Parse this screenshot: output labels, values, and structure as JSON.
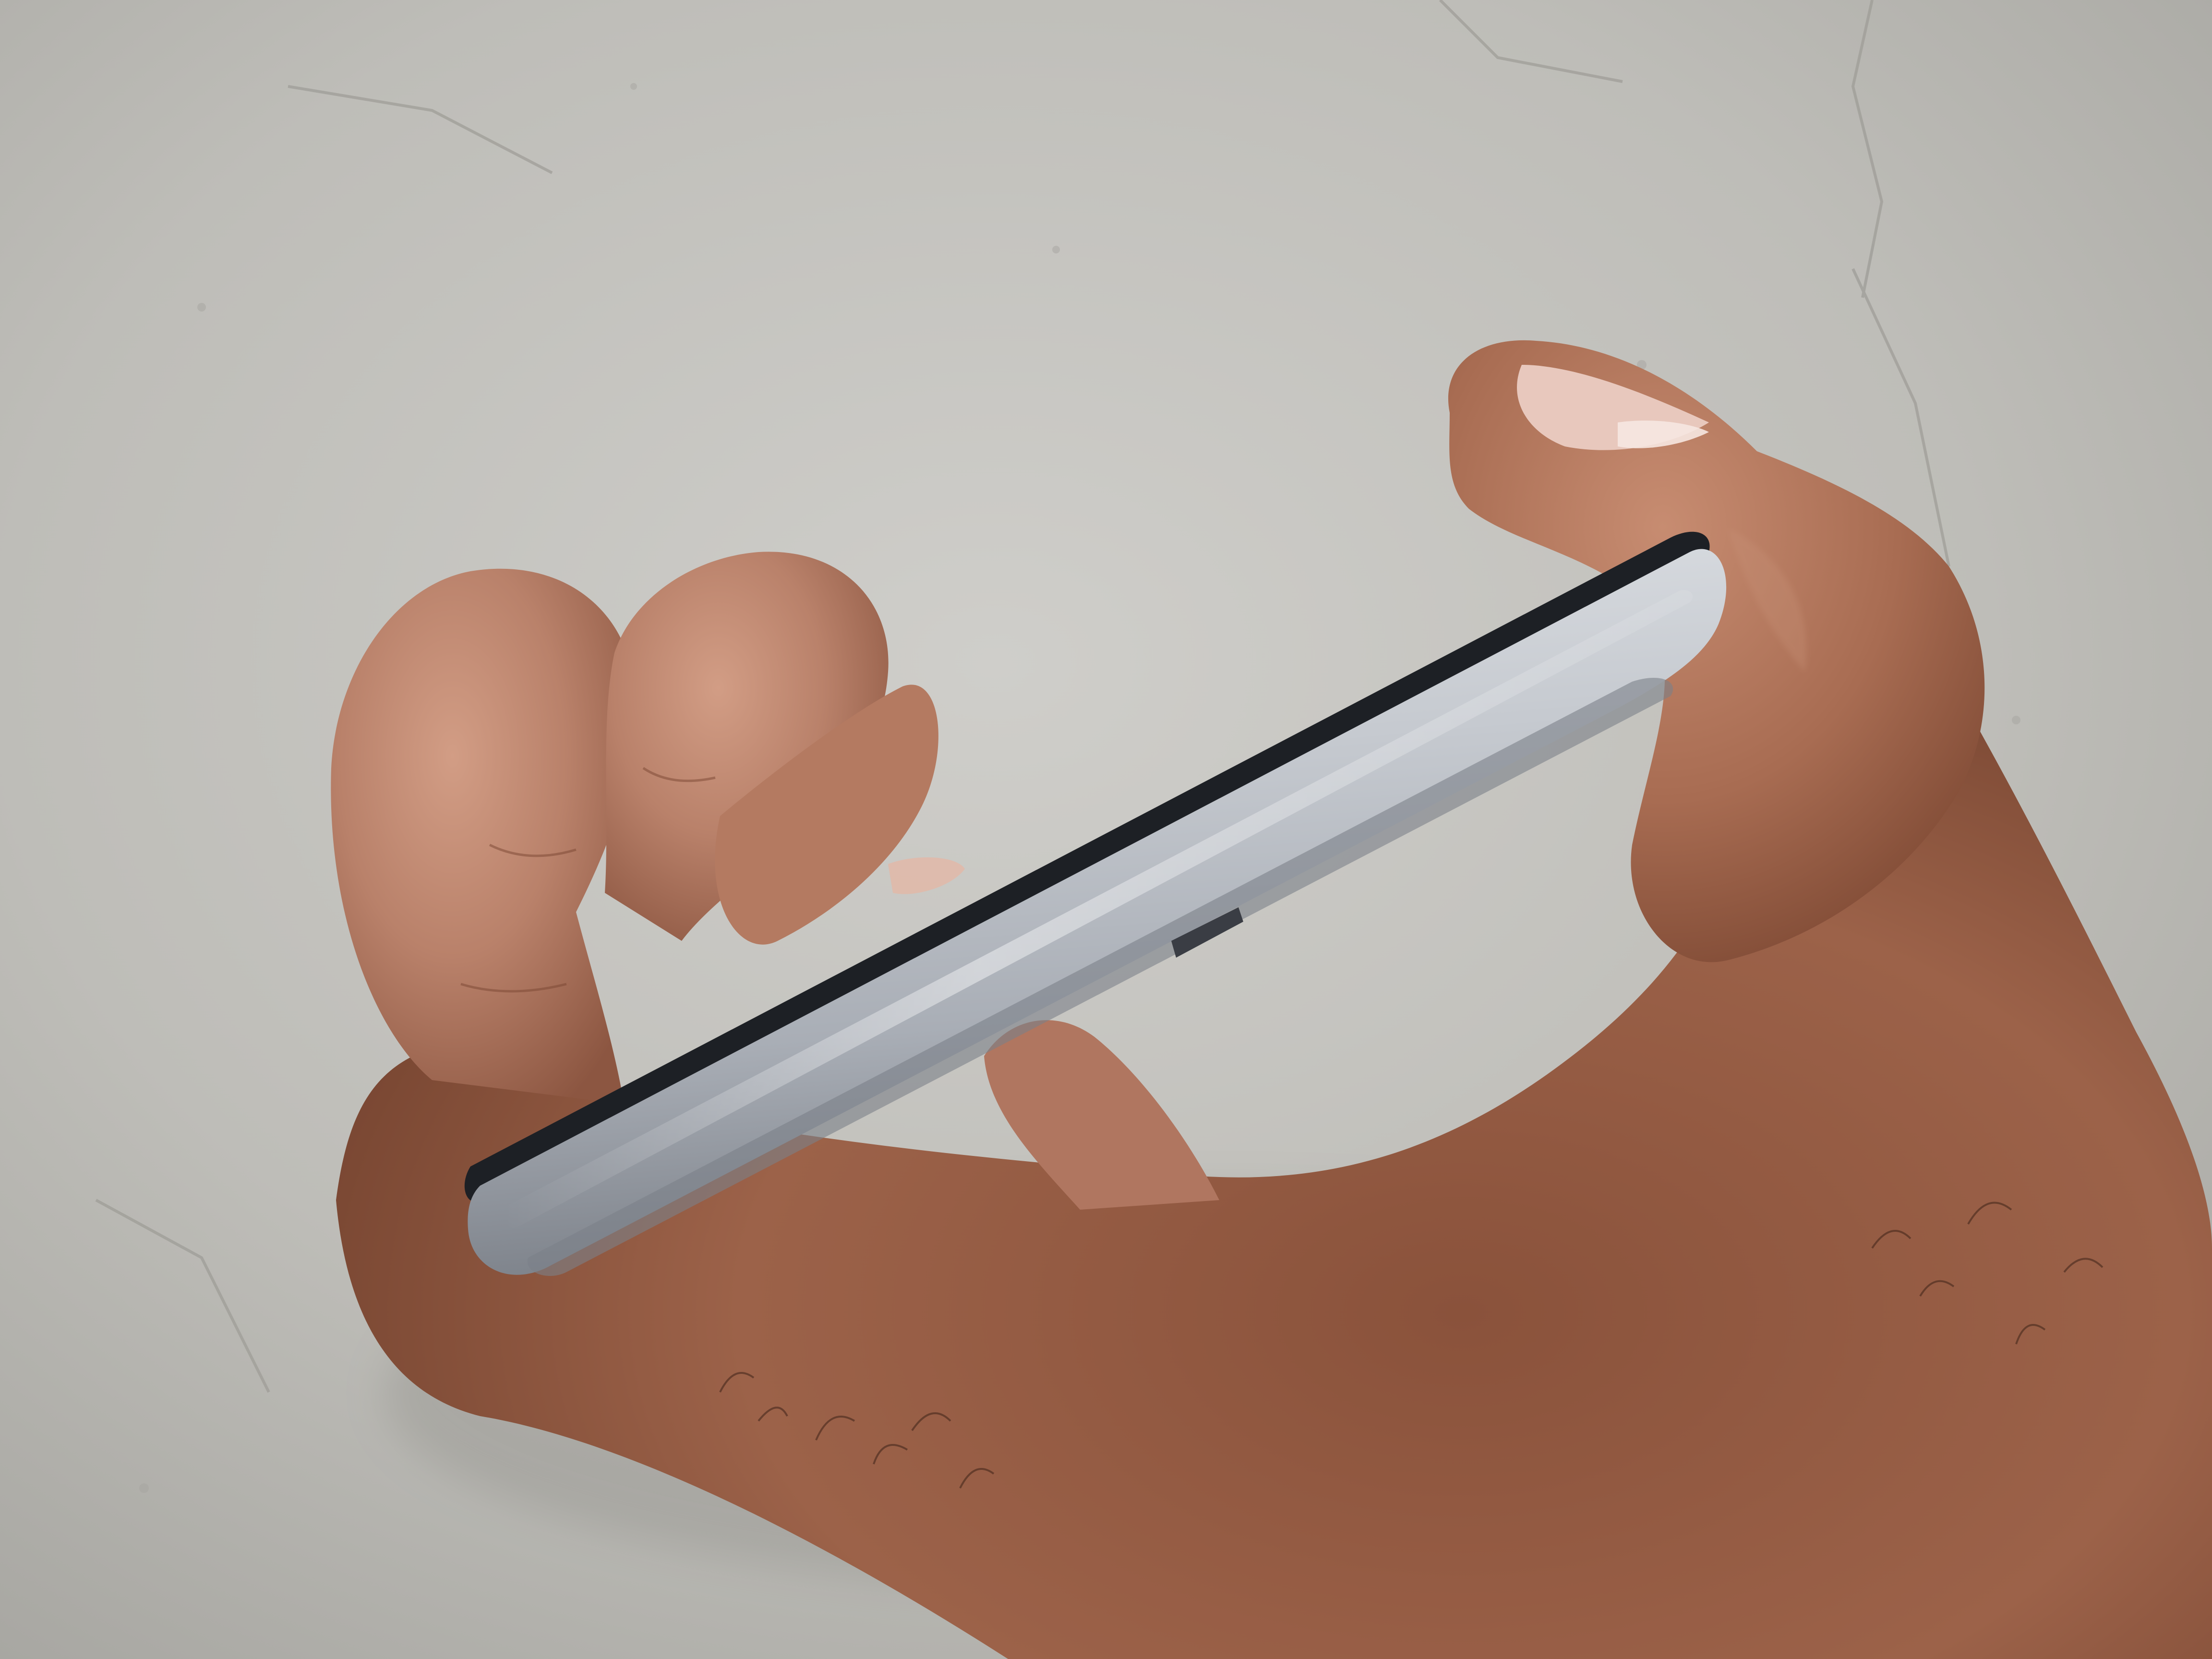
{
  "photo": {
    "subject": "hand-holding-phone-edge",
    "colors": {
      "floor_light": "#c9c8c3",
      "floor_mid": "#b8b7b2",
      "floor_dark": "#a9a8a3",
      "floor_crack": "#8f8e89",
      "skin_light": "#c48e73",
      "skin_mid": "#a86c52",
      "skin_dark": "#7d4a35",
      "skin_shadow": "#5e3424",
      "nail": "#e6c4b8",
      "phone_highlight": "#e8eaed",
      "phone_body": "#b4b8bf",
      "phone_shadow": "#6f747c",
      "phone_glass": "#1c1f24"
    }
  }
}
